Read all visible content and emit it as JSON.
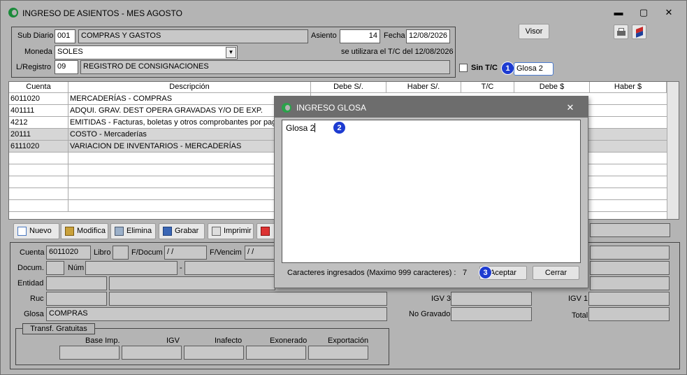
{
  "window": {
    "title": "INGRESO DE ASIENTOS - MES AGOSTO",
    "min": "▬",
    "max": "▢",
    "close": "✕"
  },
  "header": {
    "sub_diario_label": "Sub Diario",
    "sub_diario_code": "001",
    "sub_diario_name": "COMPRAS Y GASTOS",
    "asiento_label": "Asiento",
    "asiento_value": "14",
    "fecha_label": "Fecha",
    "fecha_value": "12/08/2026",
    "moneda_label": "Moneda",
    "moneda_value": "SOLES",
    "tc_note": "se utilizara el T/C del 12/08/2026",
    "lregistro_label": "L/Registro",
    "lregistro_code": "09",
    "lregistro_name": "REGISTRO DE CONSIGNACIONES",
    "visor_label": "Visor",
    "sin_tc_label": "Sin T/C",
    "glosa_value": "Glosa 2"
  },
  "grid": {
    "columns": [
      "Cuenta",
      "Descripción",
      "Debe S/.",
      "Haber S/.",
      "T/C",
      "Debe $",
      "Haber $"
    ],
    "rows": [
      {
        "cuenta": "6011020",
        "descripcion": "MERCADERÍAS - COMPRAS"
      },
      {
        "cuenta": "401111",
        "descripcion": "ADQUI. GRAV. DEST OPERA GRAVADAS Y/O DE EXP."
      },
      {
        "cuenta": "4212",
        "descripcion": "EMITIDAS - Facturas, boletas y otros comprobantes por pagar"
      },
      {
        "cuenta": "20111",
        "descripcion": "COSTO - Mercaderías"
      },
      {
        "cuenta": "6111020",
        "descripcion": "VARIACION DE INVENTARIOS - MERCADERÍAS"
      }
    ]
  },
  "toolbar": {
    "nuevo": "Nuevo",
    "modifica": "Modifica",
    "elimina": "Elimina",
    "grabar": "Grabar",
    "imprimir": "Imprimir"
  },
  "detail": {
    "cuenta_label": "Cuenta",
    "cuenta_value": "6011020",
    "libro_label": "Libro",
    "fdocum_label": "F/Docum",
    "fdocum_value": " / /",
    "fvencim_label": "F/Vencim",
    "fvencim_value": " / /",
    "docum_label": "Docum.",
    "num_label": "Núm",
    "dash": "-",
    "entidad_label": "Entidad",
    "ruc_label": "Ruc",
    "glosa_label": "Glosa",
    "glosa_value": "COMPRAS",
    "igv3_label": "IGV 3",
    "no_gravado_label": "No Gravado",
    "igv1_label": "IGV 1",
    "total_label": "Total",
    "transf_label": "Transf. Gratuitas",
    "base_imp_label": "Base Imp.",
    "igv_label": "IGV",
    "inafecto_label": "Inafecto",
    "exonerado_label": "Exonerado",
    "exportacion_label": "Exportación"
  },
  "dialog": {
    "title": "INGRESO GLOSA",
    "text": "Glosa 2",
    "counter_label": "Caracteres ingresados (Maximo 999 caracteres) :",
    "counter_value": "7",
    "accept": "Aceptar",
    "close": "Cerrar",
    "close_icon": "✕"
  },
  "badges": [
    "1",
    "2",
    "3"
  ],
  "colors": {
    "accent_badge": "#1d3bd1",
    "dialog_title": "#6d6d6d",
    "logo": "#1a8a3a"
  }
}
